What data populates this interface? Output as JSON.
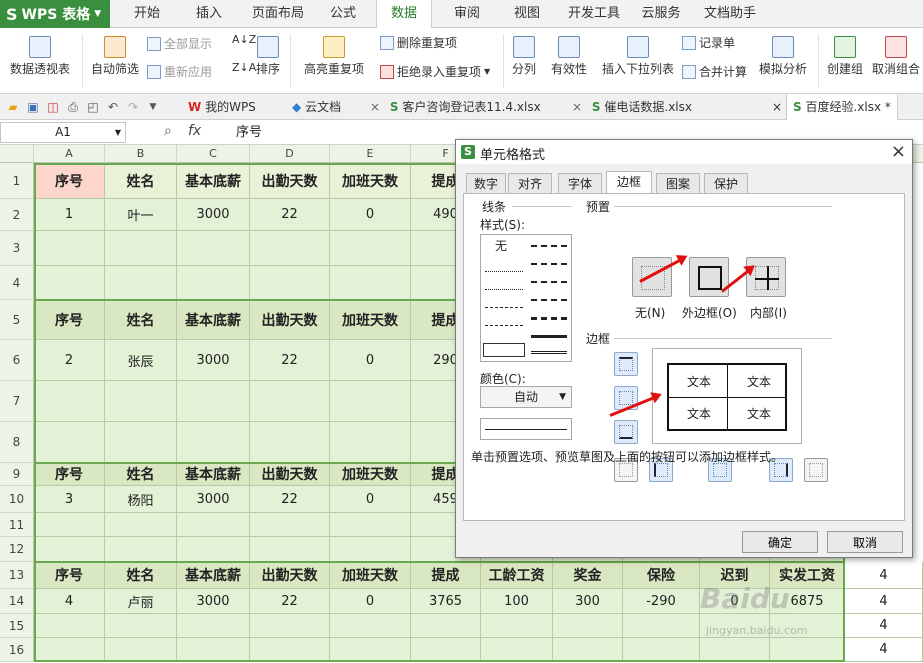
{
  "app": {
    "name": "WPS 表格",
    "logo": "S"
  },
  "menu": [
    "开始",
    "插入",
    "页面布局",
    "公式",
    "数据",
    "审阅",
    "视图",
    "开发工具",
    "云服务",
    "文档助手"
  ],
  "ribbon": {
    "pivot": "数据透视表",
    "autofilter": "自动筛选",
    "show_all": "全部显示",
    "reapply": "重新应用",
    "sort": "排序",
    "highlight_dup": "高亮重复项",
    "delete_dup": "删除重复项",
    "reject_dup": "拒绝录入重复项",
    "split": "分列",
    "validity": "有效性",
    "insert_dropdown": "插入下拉列表",
    "record_form": "记录单",
    "merge_calc": "合并计算",
    "simulate": "模拟分析",
    "create_group": "创建组",
    "ungroup": "取消组合"
  },
  "tabs": [
    {
      "label": "我的WPS",
      "icon": "W"
    },
    {
      "label": "云文档",
      "icon": "◆"
    },
    {
      "label": "客户咨询登记表11.4.xlsx",
      "icon": "S"
    },
    {
      "label": "催电话数据.xlsx",
      "icon": "S"
    },
    {
      "label": "百度经验.xlsx *",
      "icon": "S"
    }
  ],
  "formula_bar": {
    "cell_ref": "A1",
    "fx": "fx",
    "value": "序号"
  },
  "columns": [
    "A",
    "B",
    "C",
    "D",
    "E",
    "F"
  ],
  "row_numbers": [
    "1",
    "2",
    "3",
    "4",
    "5",
    "6",
    "7",
    "8",
    "9",
    "10",
    "11",
    "12",
    "13",
    "14",
    "15",
    "16"
  ],
  "table": {
    "headers": [
      "序号",
      "姓名",
      "基本底薪",
      "出勤天数",
      "加班天数",
      "提成"
    ],
    "wide_headers": [
      "序号",
      "姓名",
      "基本底薪",
      "出勤天数",
      "加班天数",
      "提成",
      "工龄工资",
      "奖金",
      "保险",
      "迟到",
      "实发工资"
    ],
    "row2": [
      "1",
      "叶一",
      "3000",
      "22",
      "0",
      "490"
    ],
    "row6": [
      "2",
      "张辰",
      "3000",
      "22",
      "0",
      "290"
    ],
    "row10": [
      "3",
      "杨阳",
      "3000",
      "22",
      "0",
      "459"
    ],
    "row14": [
      "4",
      "卢丽",
      "3000",
      "22",
      "0",
      "3765",
      "100",
      "300",
      "-290",
      "0",
      "6875"
    ],
    "right_col": [
      "4",
      "4",
      "4",
      "4"
    ]
  },
  "dialog": {
    "title": "单元格格式",
    "tabs": [
      "数字",
      "对齐",
      "字体",
      "边框",
      "图案",
      "保护"
    ],
    "active_tab": "边框",
    "line_group": "线条",
    "style_label": "样式(S):",
    "none_label": "无",
    "color_label": "颜色(C):",
    "color_value": "自动",
    "preset_group": "预置",
    "preset_none": "无(N)",
    "preset_outline": "外边框(O)",
    "preset_inside": "内部(I)",
    "border_group": "边框",
    "preview_text": "文本",
    "hint": "单击预置选项、预览草图及上面的按钮可以添加边框样式。",
    "ok": "确定",
    "cancel": "取消"
  },
  "watermark": {
    "brand": "Baidu",
    "url": "jingyan.baidu.com"
  }
}
